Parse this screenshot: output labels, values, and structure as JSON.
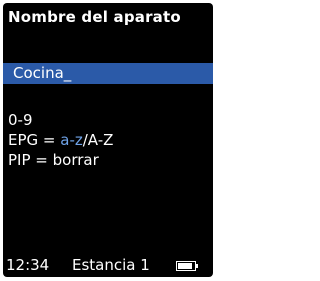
{
  "title": "Nombre del aparato",
  "input": {
    "value": "Cocina_"
  },
  "help": {
    "line1": "0-9",
    "line2_prefix": "EPG = ",
    "line2_highlight": "a-z",
    "line2_suffix": "/A-Z",
    "line3": "PIP  = borrar"
  },
  "status": {
    "time": "12:34",
    "room": "Estancia 1",
    "battery_icon": "battery-icon"
  },
  "colors": {
    "background": "#000000",
    "highlight_bar": "#2b5aa8",
    "accent_text": "#6fa3e8",
    "text": "#ffffff"
  }
}
